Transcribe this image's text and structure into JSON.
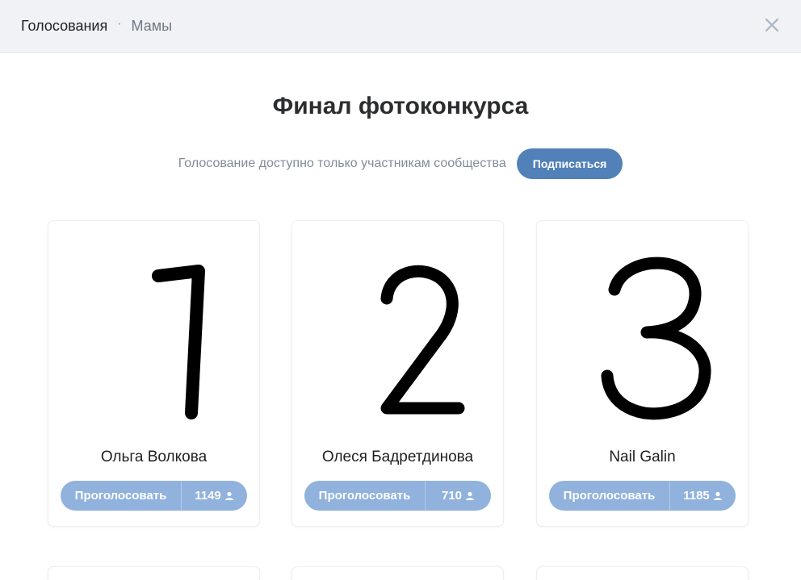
{
  "header": {
    "breadcrumb_main": "Голосования",
    "breadcrumb_separator": "·",
    "breadcrumb_sub": "Мамы",
    "close_icon": "close-icon"
  },
  "title": "Финал фотоконкурса",
  "notice": {
    "text": "Голосование доступно только участникам сообщества",
    "subscribe_label": "Подписаться"
  },
  "cards": [
    {
      "photo_digit": "1",
      "name": "Ольга Волкова",
      "vote_label": "Проголосовать",
      "votes": "1149"
    },
    {
      "photo_digit": "2",
      "name": "Олеся Бадретдинова",
      "vote_label": "Проголосовать",
      "votes": "710"
    },
    {
      "photo_digit": "3",
      "name": "Nail Galin",
      "vote_label": "Проголосовать",
      "votes": "1185"
    }
  ],
  "colors": {
    "accent": "#5181b8",
    "vote_button": "#90b2dd",
    "header_bg": "#f0f2f5"
  }
}
